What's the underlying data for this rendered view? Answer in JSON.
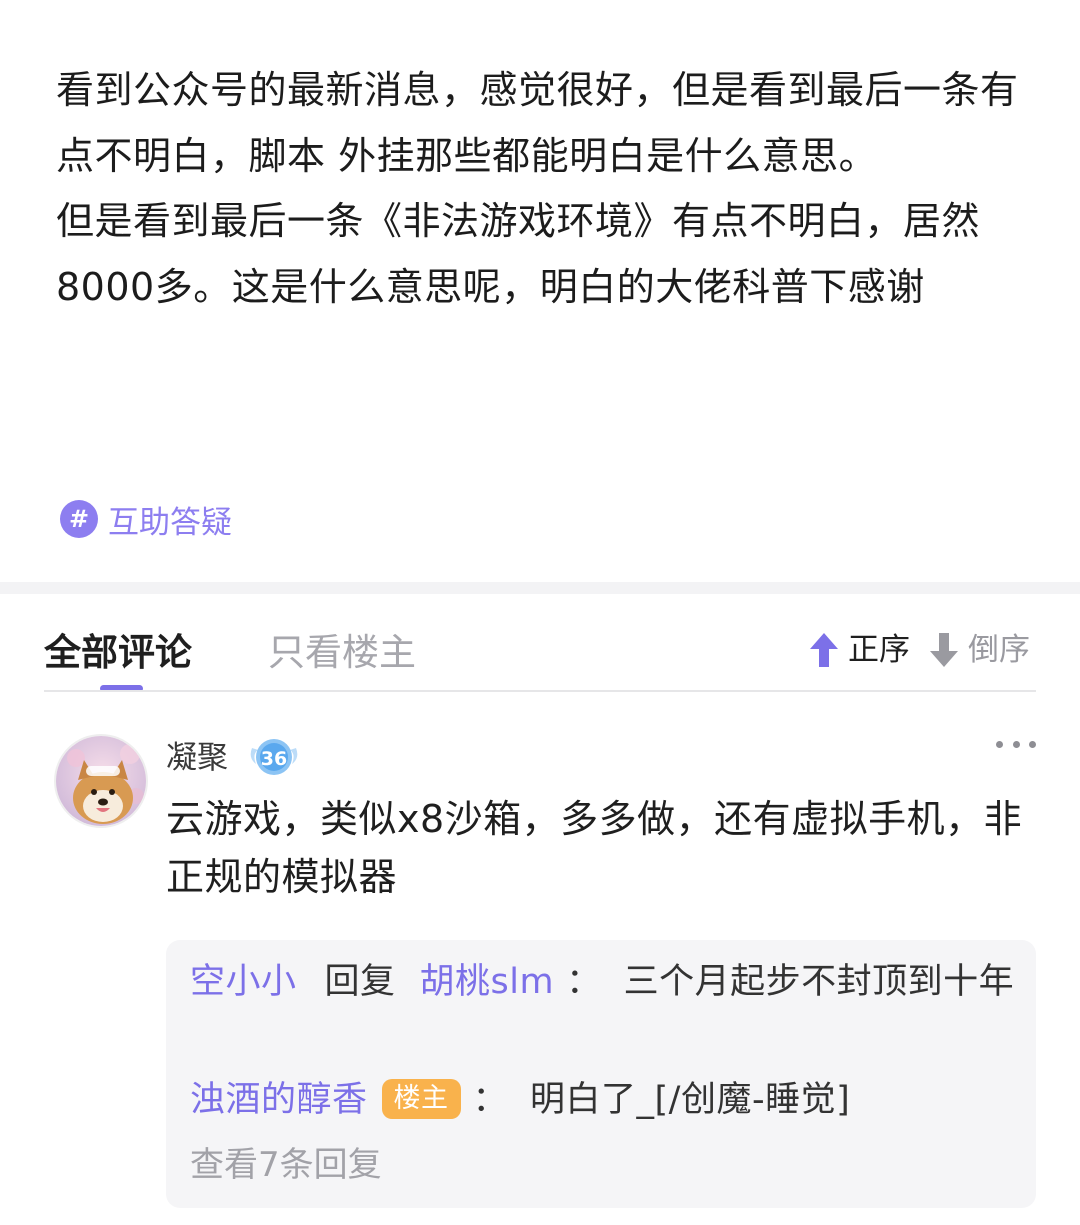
{
  "post": {
    "paragraphs": [
      "看到公众号的最新消息，感觉很好，但是看到最后一条有点不明白，脚本  外挂那些都能明白是什么意思。",
      "但是看到最后一条《非法游戏环境》有点不明白，居然8000多。这是什么意思呢，明白的大佬科普下感谢"
    ],
    "tag": {
      "icon": "#",
      "label": "互助答疑"
    }
  },
  "tabs": {
    "all_label": "全部评论",
    "owner_label": "只看楼主",
    "sort_asc_label": "正序",
    "sort_desc_label": "倒序"
  },
  "comment": {
    "user_name": "凝聚",
    "level": "36",
    "text": "云游戏，类似x8沙箱，多多做，还有虚拟手机，非正规的模拟器",
    "replies": [
      {
        "from": "空小小",
        "reply_word": "回复",
        "to": "胡桃slm",
        "colon": "：",
        "text": "三个月起步不封顶到十年"
      },
      {
        "from": "浊酒的醇香",
        "badge": "楼主",
        "colon": "：",
        "text": "明白了_[/创魔-睡觉]"
      }
    ],
    "view_more": "查看7条回复"
  },
  "colors": {
    "accent": "#7c70e8",
    "tag_accent": "#8d7ef0",
    "owner_badge": "#f9b24c",
    "muted": "#a7a7ad"
  },
  "icons": {
    "tag": "hashtag-icon",
    "sort_asc": "arrow-up-icon",
    "sort_desc": "arrow-down-icon",
    "more": "more-dots-icon",
    "level": "level-badge-icon"
  }
}
